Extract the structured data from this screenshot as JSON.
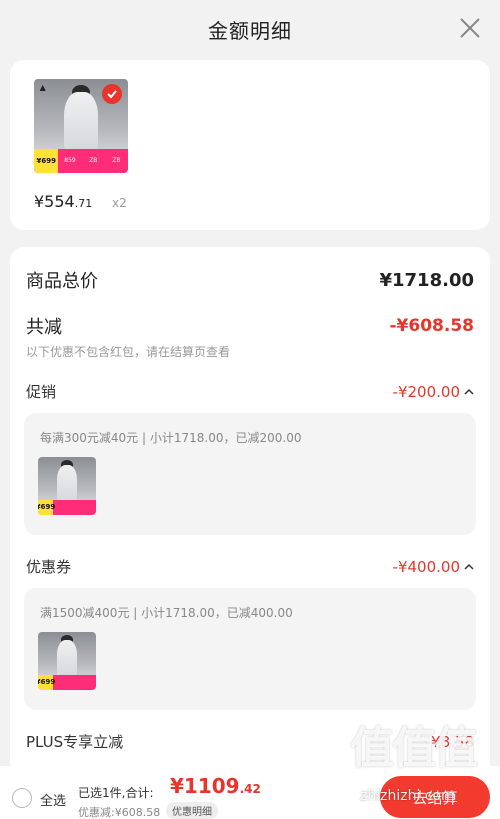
{
  "header": {
    "title": "金额明细"
  },
  "product": {
    "price_int": "¥554",
    "price_dec": ".71",
    "qty": "x2",
    "thumb_price": "¥699",
    "thumb_cells": [
      "859",
      "ZB",
      "ZB"
    ]
  },
  "summary": {
    "total_label": "商品总价",
    "total_value": "¥1718.00",
    "discount_label": "共减",
    "discount_value": "-¥608.58",
    "discount_note": "以下优惠不包含红包，请在结算页查看"
  },
  "promo": {
    "label": "促销",
    "value": "-¥200.00",
    "detail": "每满300元减40元 | 小计1718.00，已减200.00"
  },
  "coupon": {
    "label": "优惠券",
    "value": "-¥400.00",
    "detail": "满1500减400元 | 小计1718.00，已减400.00"
  },
  "plus": {
    "label": "PLUS专享立减",
    "value": "-¥8.58"
  },
  "footer": {
    "select_all": "全选",
    "selected": "已选1件,合计:",
    "total_int": "¥1109",
    "total_dec": ".42",
    "saved": "优惠减:¥608.58",
    "detail_btn": "优惠明细",
    "settle": "去结算"
  },
  "watermark": {
    "big": "值值值",
    "small": "zhizhizhi.com"
  },
  "colors": {
    "accent": "#e8342b"
  }
}
